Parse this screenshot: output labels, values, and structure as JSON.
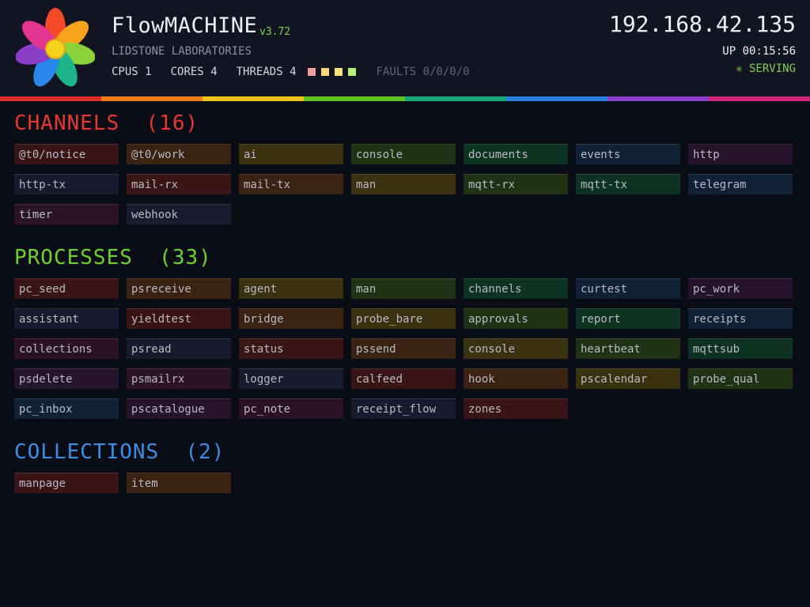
{
  "header": {
    "app_name": "FlowMACHINE",
    "version": "v3.72",
    "company": "LIDSTONE LABORATORIES",
    "stats": [
      {
        "label": "CPUS",
        "value": "1"
      },
      {
        "label": "CORES",
        "value": "4"
      },
      {
        "label": "THREADS",
        "value": "4"
      }
    ],
    "thread_colors": [
      "#f0a09a",
      "#f4d77a",
      "#f4e27a",
      "#b7ee7a"
    ],
    "faults": "FAULTS 0/0/0/0",
    "ip": "192.168.42.135",
    "uptime": "UP 00:15:56",
    "status": "✳ SERVING",
    "rainbow": [
      "#e02b2b",
      "#ef7a1a",
      "#f0c21c",
      "#62c424",
      "#17a878",
      "#2b7fe0",
      "#8a3ec8",
      "#d0237c"
    ]
  },
  "sections": [
    {
      "key": "channels",
      "title": "CHANNELS  (16)",
      "color": "#e6382e",
      "items": [
        "@t0/notice",
        "@t0/work",
        "ai",
        "console",
        "documents",
        "events",
        "http",
        "http-tx",
        "mail-rx",
        "mail-tx",
        "man",
        "mqtt-rx",
        "mqtt-tx",
        "telegram",
        "timer",
        "webhook"
      ]
    },
    {
      "key": "processes",
      "title": "PROCESSES  (33)",
      "color": "#6fd12e",
      "items": [
        "pc_seed",
        "psreceive",
        "agent",
        "man",
        "channels",
        "curtest",
        "pc_work",
        "assistant",
        "yieldtest",
        "bridge",
        "probe_bare",
        "approvals",
        "report",
        "receipts",
        "collections",
        "psread",
        "status",
        "pssend",
        "console",
        "heartbeat",
        "mqttsub",
        "psdelete",
        "psmailrx",
        "logger",
        "calfeed",
        "hook",
        "pscalendar",
        "probe_qual",
        "pc_inbox",
        "pscatalogue",
        "pc_note",
        "receipt_flow",
        "zones"
      ]
    },
    {
      "key": "collections",
      "title": "COLLECTIONS  (2)",
      "color": "#3a8ee6",
      "items": [
        "manpage",
        "item"
      ]
    }
  ]
}
